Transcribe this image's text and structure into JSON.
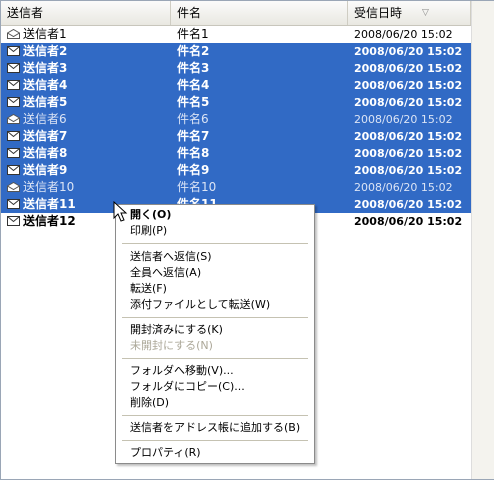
{
  "columns": {
    "sender": "送信者",
    "subject": "件名",
    "received": "受信日時"
  },
  "sort_indicator": "▽",
  "colors": {
    "selection": "#316ac5",
    "header_bg": "#ece9d8",
    "menu_border": "#8b8b8b"
  },
  "rows": [
    {
      "sender": "送信者1",
      "subject": "件名1",
      "date": "2008/06/20 15:02",
      "icon": "open-envelope-icon",
      "selected": false,
      "unread": false
    },
    {
      "sender": "送信者2",
      "subject": "件名2",
      "date": "2008/06/20 15:02",
      "icon": "closed-envelope-icon",
      "selected": true,
      "unread": true
    },
    {
      "sender": "送信者3",
      "subject": "件名3",
      "date": "2008/06/20 15:02",
      "icon": "closed-envelope-icon",
      "selected": true,
      "unread": true
    },
    {
      "sender": "送信者4",
      "subject": "件名4",
      "date": "2008/06/20 15:02",
      "icon": "closed-envelope-icon",
      "selected": true,
      "unread": true
    },
    {
      "sender": "送信者5",
      "subject": "件名5",
      "date": "2008/06/20 15:02",
      "icon": "closed-envelope-icon",
      "selected": true,
      "unread": true
    },
    {
      "sender": "送信者6",
      "subject": "件名6",
      "date": "2008/06/20 15:02",
      "icon": "open-envelope-icon",
      "selected": true,
      "unread": false
    },
    {
      "sender": "送信者7",
      "subject": "件名7",
      "date": "2008/06/20 15:02",
      "icon": "closed-envelope-icon",
      "selected": true,
      "unread": true
    },
    {
      "sender": "送信者8",
      "subject": "件名8",
      "date": "2008/06/20 15:02",
      "icon": "closed-envelope-icon",
      "selected": true,
      "unread": true
    },
    {
      "sender": "送信者9",
      "subject": "件名9",
      "date": "2008/06/20 15:02",
      "icon": "closed-envelope-icon",
      "selected": true,
      "unread": true
    },
    {
      "sender": "送信者10",
      "subject": "件名10",
      "date": "2008/06/20 15:02",
      "icon": "open-envelope-icon",
      "selected": true,
      "unread": false
    },
    {
      "sender": "送信者11",
      "subject": "件名11",
      "date": "2008/06/20 15:02",
      "icon": "closed-envelope-icon",
      "selected": true,
      "unread": true
    },
    {
      "sender": "送信者12",
      "subject": "件名12",
      "date": "2008/06/20 15:02",
      "icon": "closed-envelope-icon",
      "selected": false,
      "unread": true
    }
  ],
  "context_menu": {
    "open": "開く(O)",
    "print": "印刷(P)",
    "reply_sender": "送信者へ返信(S)",
    "reply_all": "全員へ返信(A)",
    "forward": "転送(F)",
    "forward_attachment": "添付ファイルとして転送(W)",
    "mark_read": "開封済みにする(K)",
    "mark_unread": "未開封にする(N)",
    "move_to_folder": "フォルダへ移動(V)...",
    "copy_to_folder": "フォルダにコピー(C)...",
    "delete": "削除(D)",
    "add_to_addressbook": "送信者をアドレス帳に追加する(B)",
    "properties": "プロパティ(R)"
  }
}
